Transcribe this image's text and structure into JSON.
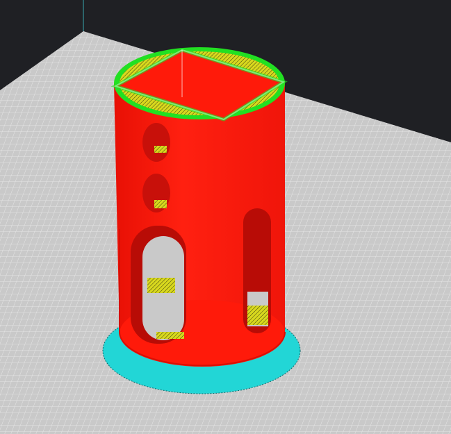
{
  "viewport": {
    "colors": {
      "background": "#1f2024",
      "build_plate": "#c9c9c9",
      "grid_line": "#e6e6e6",
      "wall": "#ff1a0a",
      "wall_shade": "#d80f05",
      "infill": "#e0e020",
      "skin": "#22e022",
      "brim": "#22d6d6"
    }
  }
}
